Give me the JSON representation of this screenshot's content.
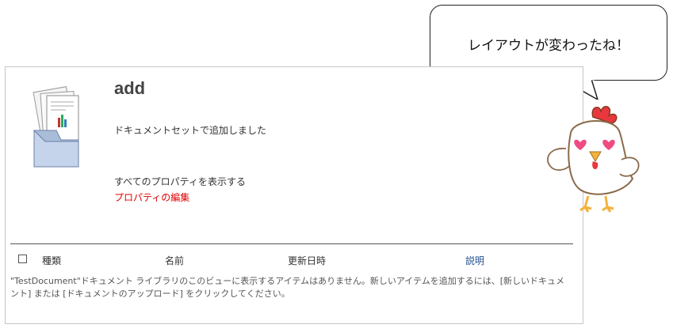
{
  "document": {
    "title": "add",
    "description": "ドキュメントセットで追加しました",
    "show_properties_link": "すべてのプロパティを表示する",
    "edit_properties_link": "プロパティの編集"
  },
  "list": {
    "columns": [
      "種類",
      "名前",
      "更新日時",
      "説明"
    ],
    "empty_message": "\"TestDocument\"ドキュメント ライブラリのこのビューに表示するアイテムはありません。新しいアイテムを追加するには、[新しいドキュメント] または [ドキュメントのアップロード] をクリックしてください。"
  },
  "annotation": {
    "bubble_text": "レイアウトが変わったね！"
  },
  "colors": {
    "link_red": "#e00000",
    "link_blue": "#1e4f8e",
    "chicken_comb": "#e8383d",
    "chicken_beak": "#f3b23c"
  },
  "icons": [
    "document-set-icon",
    "chicken-mascot-icon"
  ]
}
